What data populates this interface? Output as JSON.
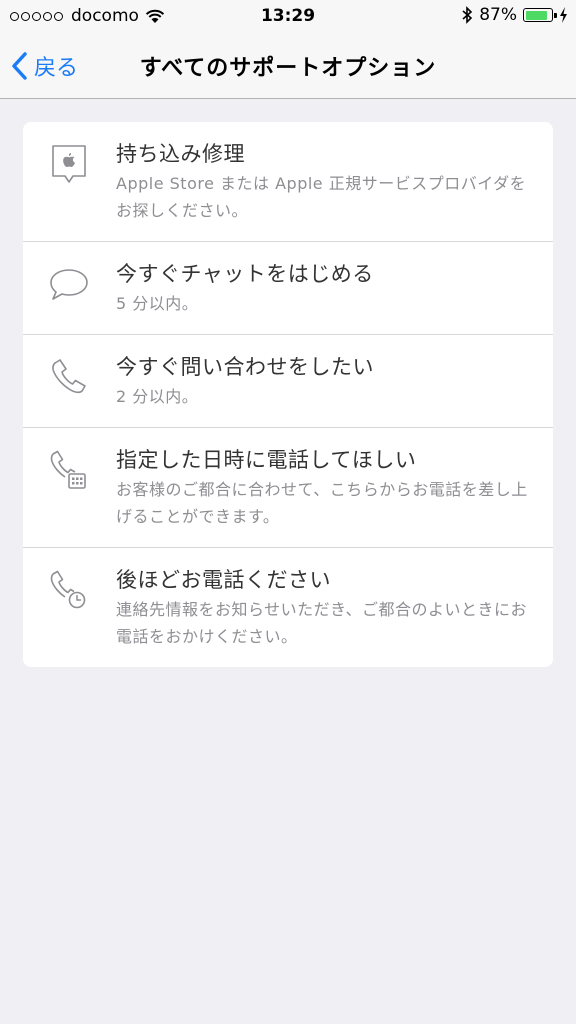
{
  "status_bar": {
    "carrier": "docomo",
    "time": "13:29",
    "battery_percent": "87%",
    "battery_level": 0.87,
    "battery_color": "#4cd964"
  },
  "nav": {
    "back_label": "戻る",
    "title": "すべてのサポートオプション",
    "accent_color": "#1a7cf6"
  },
  "options": [
    {
      "icon": "apple-store-pin-icon",
      "title": "持ち込み修理",
      "subtitle": "Apple Store または Apple 正規サービスプロバイダをお探しください。"
    },
    {
      "icon": "chat-bubble-icon",
      "title": "今すぐチャットをはじめる",
      "subtitle": "5 分以内。"
    },
    {
      "icon": "phone-icon",
      "title": "今すぐ問い合わせをしたい",
      "subtitle": "2 分以内。"
    },
    {
      "icon": "phone-calendar-icon",
      "title": "指定した日時に電話してほしい",
      "subtitle": "お客様のご都合に合わせて、こちらからお電話を差し上げることができます。"
    },
    {
      "icon": "phone-clock-icon",
      "title": "後ほどお電話ください",
      "subtitle": "連絡先情報をお知らせいただき、ご都合のよいときにお電話をおかけください。"
    }
  ]
}
